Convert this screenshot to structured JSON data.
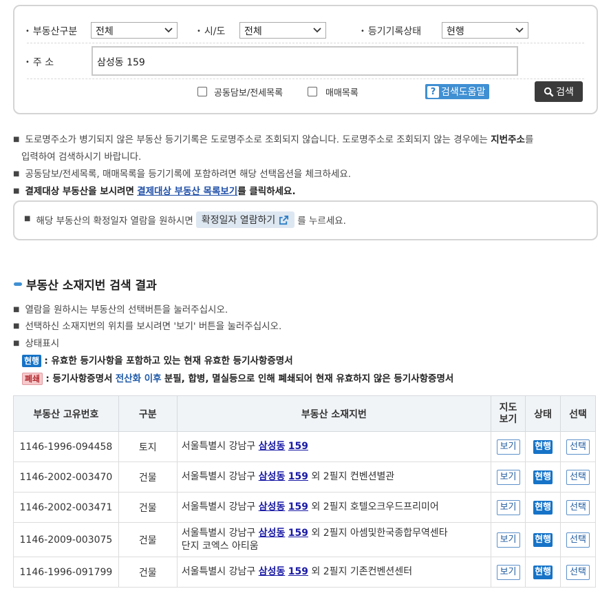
{
  "search": {
    "property_type_label": "부동산구분",
    "property_type_value": "전체",
    "region_label": "시/도",
    "region_value": "전체",
    "registry_status_label": "등기기록상태",
    "registry_status_value": "현행",
    "address_label": "주 소",
    "address_value": "삼성동 159",
    "checkbox_joint_label": "공동담보/전세목록",
    "checkbox_sale_label": "매매목록",
    "help_label": "검색도움말",
    "search_label": "검색"
  },
  "notes": {
    "n1a": "도로명주소가 병기되지 않은 부동산 등기기록은 도로명주소로 조회되지 않습니다. 도로명주소로 조회되지 않는 경우에는",
    "n1b": "지번주소",
    "n1c": "를",
    "n1d": "입력하여 검색하시기 바랍니다.",
    "n2": "공동담보/전세목록, 매매목록을 등기기록에 포함하려면 해당 선택옵션을 체크하세요.",
    "n3a": "결제대상 부동산을 보시려면",
    "n3b": "결제대상 부동산 목록보기",
    "n3c": "를 클릭하세요.",
    "info_a": "해당 부동산의 확정일자 열람을 원하시면",
    "info_btn": "확정일자 열람하기",
    "info_c": "를 누르세요."
  },
  "results": {
    "title": "부동산 소재지번 검색 결과",
    "g1": "열람을 원하시는 부동산의 선택버튼을 눌러주십시오.",
    "g2": "선택하신 소재지번의 위치를 보시려면 '보기' 버튼을 눌러주십시오.",
    "g3": "상태표시",
    "badge_active": "현행",
    "badge_active_desc": ": 유효한 등기사항을 포함하고 있는 현재 유효한 등기사항증명서",
    "badge_closed": "폐쇄",
    "badge_closed_desc_a": ": 등기사항증명서",
    "badge_closed_desc_b": "전산화 이후",
    "badge_closed_desc_c": "분필, 합병, 멸실등으로 인해 폐쇄되어 현재 유효하지 않은 등기사항증명서"
  },
  "table": {
    "headers": {
      "id": "부동산 고유번호",
      "kind": "구분",
      "address": "부동산 소재지번",
      "map": "지도보기",
      "status": "상태",
      "select": "선택"
    },
    "view_label": "보기",
    "select_label": "선택",
    "rows": [
      {
        "id": "1146-1996-094458",
        "kind": "토지",
        "addr_pre": "서울특별시 강남구",
        "dong": "삼성동",
        "num": "159",
        "addr_post": "",
        "status": "현행"
      },
      {
        "id": "1146-2002-003470",
        "kind": "건물",
        "addr_pre": "서울특별시 강남구",
        "dong": "삼성동",
        "num": "159",
        "addr_post": "외 2필지 컨벤션별관",
        "status": "현행"
      },
      {
        "id": "1146-2002-003471",
        "kind": "건물",
        "addr_pre": "서울특별시 강남구",
        "dong": "삼성동",
        "num": "159",
        "addr_post": "외 2필지 호텔오크우드프리미어",
        "status": "현행"
      },
      {
        "id": "1146-2009-003075",
        "kind": "건물",
        "addr_pre": "서울특별시 강남구",
        "dong": "삼성동",
        "num": "159",
        "addr_post": "외 2필지 아셈및한국종합무역센타",
        "addr_line2": "단지 코엑스 아티움",
        "status": "현행"
      },
      {
        "id": "1146-1996-091799",
        "kind": "건물",
        "addr_pre": "서울특별시 강남구",
        "dong": "삼성동",
        "num": "159",
        "addr_post": "외 2필지 기존컨벤션센터",
        "status": "현행"
      }
    ]
  }
}
